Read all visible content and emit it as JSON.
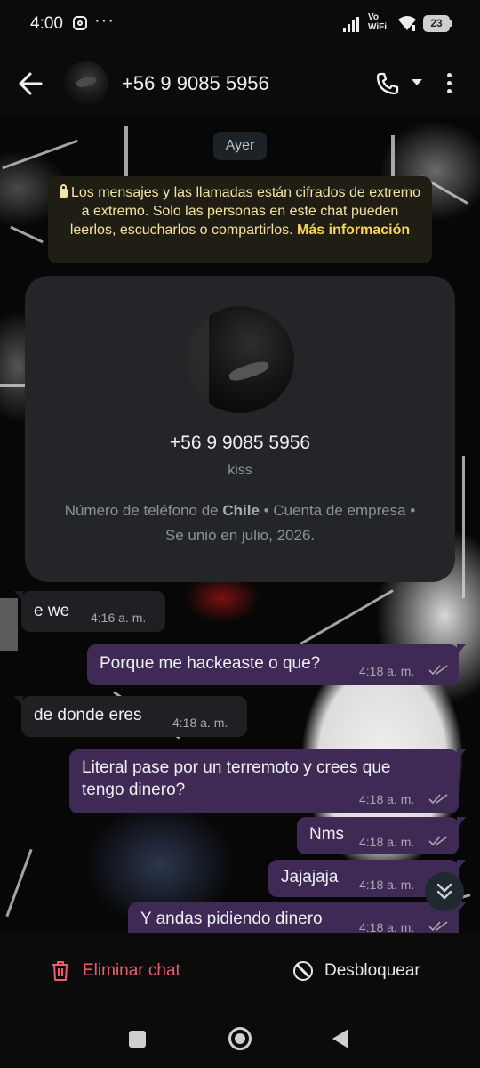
{
  "status_bar": {
    "time": "4:00",
    "dots": "···",
    "network_label": "Vo\nWiFi",
    "battery": "23"
  },
  "header": {
    "contact_name": "+56 9 9085 5956"
  },
  "chat": {
    "date_chip": "Ayer",
    "encryption_notice": {
      "text": "Los mensajes y las llamadas están cifrados de extremo a extremo. Solo las personas en este chat pueden leerlos, escucharlos o compartirlos.",
      "link": "Más información"
    },
    "profile_card": {
      "number": "+56 9 9085 5956",
      "status": "kiss",
      "info_prefix": "Número de teléfono de ",
      "info_country": "Chile",
      "info_suffix": " • Cuenta de empresa • Se unió en julio, 2026."
    },
    "messages": [
      {
        "direction": "in",
        "text": "e we",
        "time": "4:16 a. m."
      },
      {
        "direction": "out",
        "text": "Porque me hackeaste o que?",
        "time": "4:18 a. m."
      },
      {
        "direction": "in",
        "text": "de donde eres",
        "time": "4:18 a. m."
      },
      {
        "direction": "out",
        "text": "Literal pase por un terremoto y crees que",
        "text2": "tengo dinero?",
        "time": "4:18 a. m."
      },
      {
        "direction": "out",
        "text": "Nms",
        "time": "4:18 a. m."
      },
      {
        "direction": "out",
        "text": "Jajajaja",
        "time": "4:18 a. m."
      },
      {
        "direction": "out",
        "text": "Y andas pidiendo dinero",
        "time": "4:18 a. m."
      }
    ]
  },
  "actions": {
    "delete_label": "Eliminar chat",
    "unblock_label": "Desbloquear"
  },
  "colors": {
    "incoming_bubble": "#1f2023",
    "outgoing_bubble": "#3f2a56",
    "danger": "#f15c6d",
    "notice_bg": "#1f1d14",
    "notice_link": "#f8d35a"
  },
  "icons": [
    "instagram-icon",
    "signal-icon",
    "wifi-icon",
    "battery-icon",
    "back-arrow-icon",
    "phone-icon",
    "chevron-down-icon",
    "more-vert-icon",
    "lock-icon",
    "double-check-icon",
    "scroll-down-icon",
    "trash-icon",
    "block-icon",
    "nav-recents-icon",
    "nav-home-icon",
    "nav-back-icon"
  ]
}
